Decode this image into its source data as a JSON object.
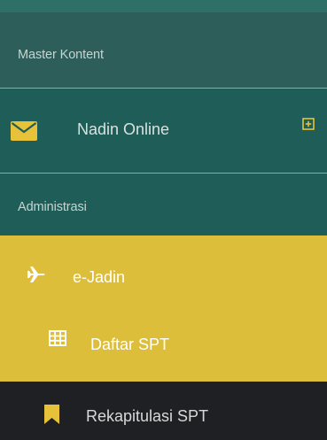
{
  "sidebar": {
    "section_master": "Master Kontent",
    "nadin_online": {
      "label": "Nadin Online",
      "icon": "envelope-icon",
      "toggle_icon": "plus-square-icon"
    },
    "section_admin": "Administrasi",
    "ejadin": {
      "label": "e-Jadin",
      "icon": "plane-icon"
    },
    "daftar_spt": {
      "label": "Daftar SPT",
      "icon": "table-icon"
    },
    "rekap_spt": {
      "label": "Rekapitulasi SPT",
      "icon": "bookmark-icon"
    }
  },
  "colors": {
    "teal_dark": "#1e5d58",
    "teal_header": "#2d5e5a",
    "active_yellow": "#ddbe3a",
    "dark_item": "#1f2024",
    "accent_yellow": "#e6c23a"
  }
}
